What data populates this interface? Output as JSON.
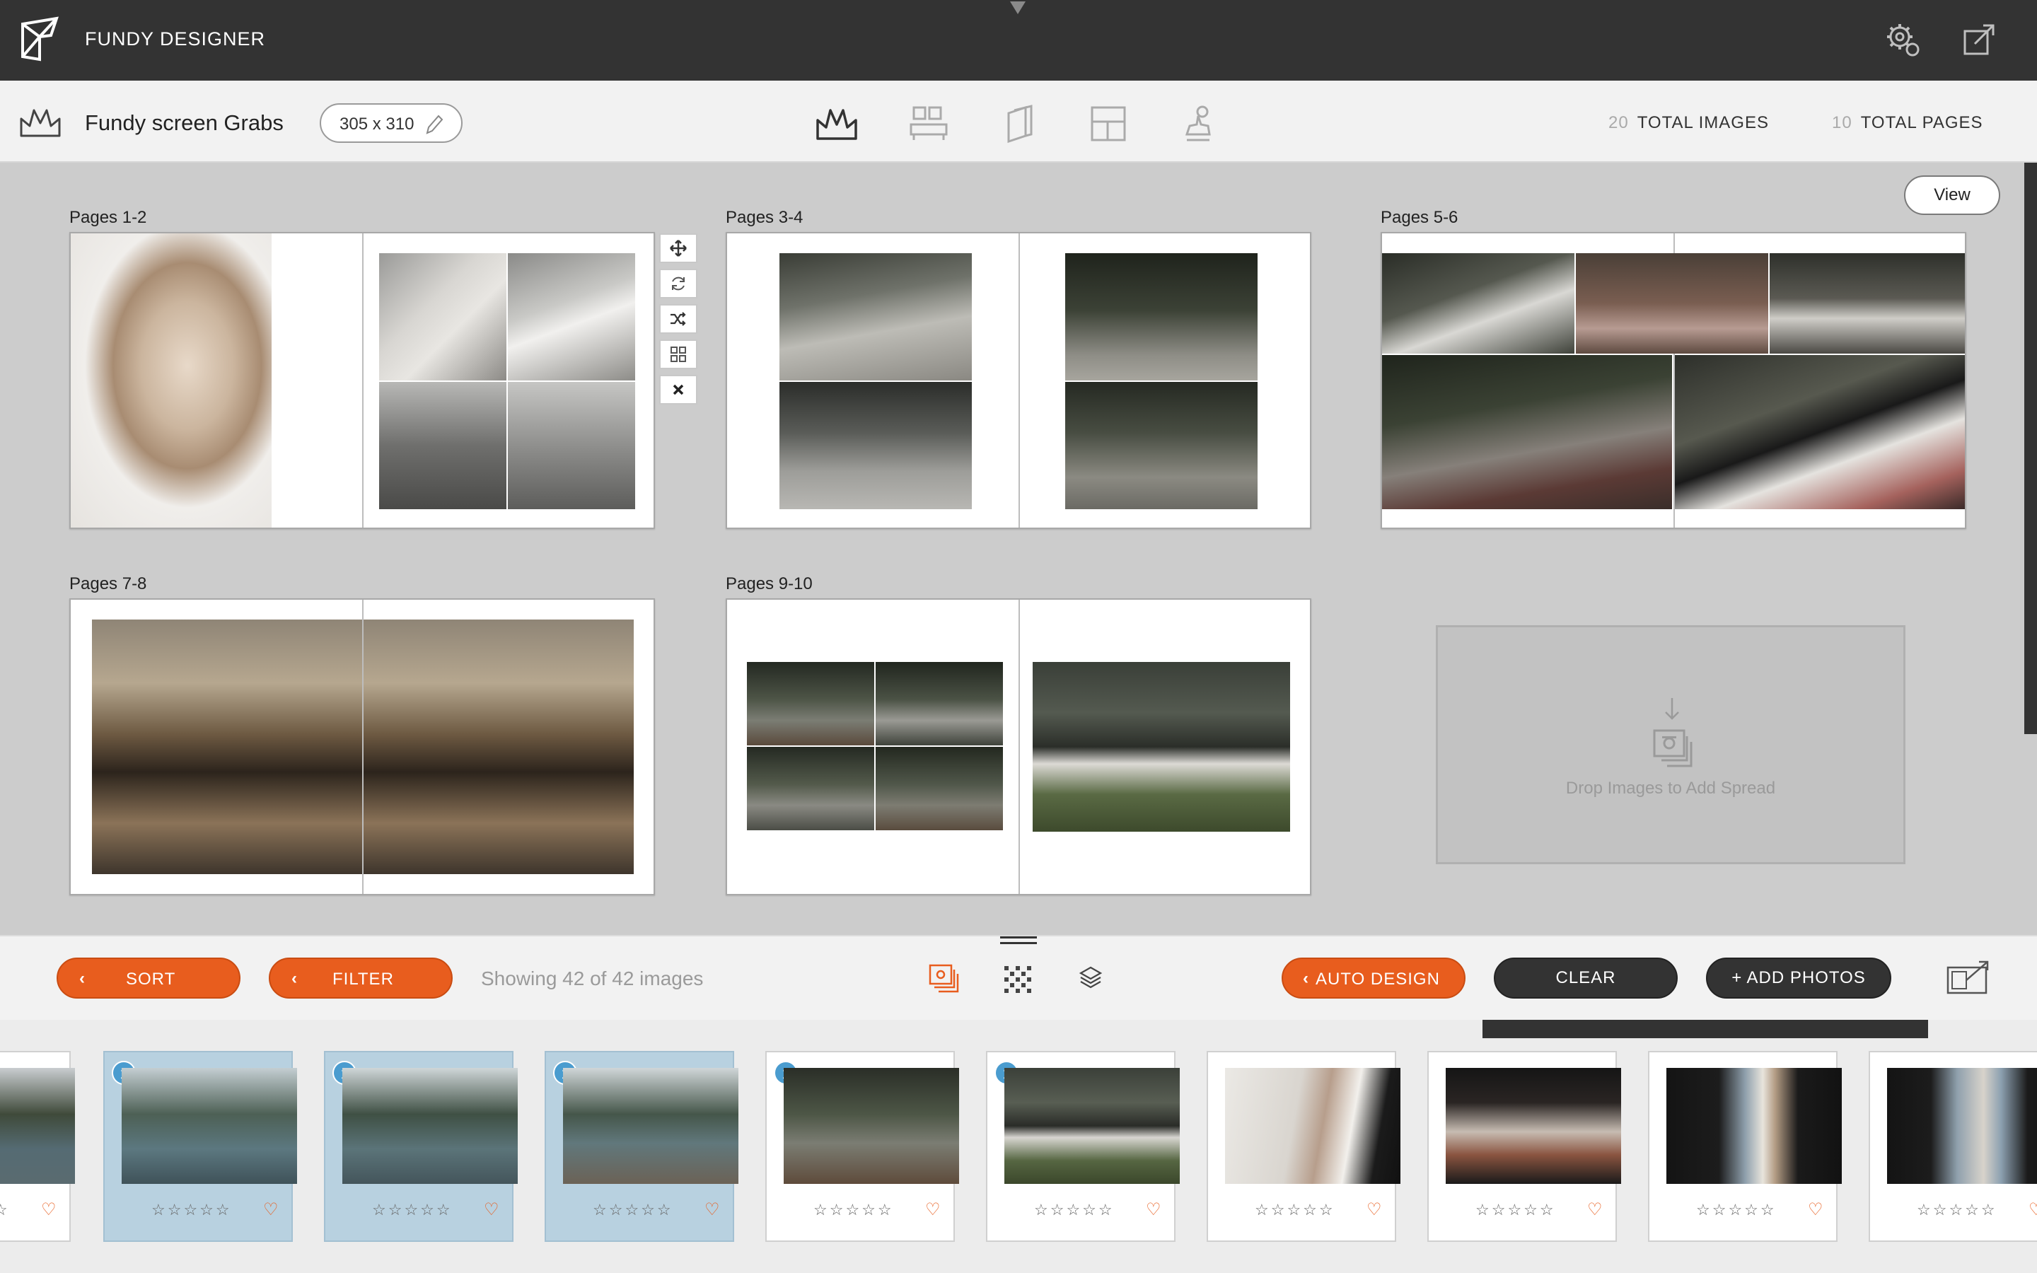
{
  "app": {
    "title": "FUNDY DESIGNER"
  },
  "project": {
    "name": "Fundy screen Grabs",
    "size": "305 x 310",
    "total_images_count": "20",
    "total_images_label": "TOTAL IMAGES",
    "total_pages_count": "10",
    "total_pages_label": "TOTAL PAGES"
  },
  "modes": [
    "album-mode-icon",
    "wall-display-icon",
    "cards-icon",
    "layout-grid-icon",
    "stamp-icon"
  ],
  "workspace": {
    "view_label": "View",
    "spreads": [
      {
        "label": "Pages 1-2"
      },
      {
        "label": "Pages 3-4"
      },
      {
        "label": "Pages 5-6"
      },
      {
        "label": "Pages 7-8"
      },
      {
        "label": "Pages 9-10"
      }
    ],
    "dropzone_text": "Drop Images to Add Spread"
  },
  "toolbar": {
    "sort_label": "SORT",
    "filter_label": "FILTER",
    "showing_text": "Showing 42 of 42 images",
    "auto_design_label": "AUTO DESIGN",
    "clear_label": "CLEAR",
    "add_photos_label": "+ ADD PHOTOS"
  },
  "filmstrip": {
    "thumbs": [
      {
        "badge": "",
        "stars": "☆☆☆☆☆",
        "heart": "♡",
        "selected": false
      },
      {
        "badge": "1",
        "stars": "☆☆☆☆☆",
        "heart": "♡",
        "selected": true
      },
      {
        "badge": "1",
        "stars": "☆☆☆☆☆",
        "heart": "♡",
        "selected": true
      },
      {
        "badge": "1",
        "stars": "☆☆☆☆☆",
        "heart": "♡",
        "selected": true
      },
      {
        "badge": "1",
        "stars": "☆☆☆☆☆",
        "heart": "♡",
        "selected": false
      },
      {
        "badge": "1",
        "stars": "☆☆☆☆☆",
        "heart": "♡",
        "selected": false
      },
      {
        "badge": "",
        "stars": "☆☆☆☆☆",
        "heart": "♡",
        "selected": false
      },
      {
        "badge": "",
        "stars": "☆☆☆☆☆",
        "heart": "♡",
        "selected": false
      },
      {
        "badge": "",
        "stars": "☆☆☆☆☆",
        "heart": "♡",
        "selected": false
      },
      {
        "badge": "",
        "stars": "☆☆☆☆☆",
        "heart": "♡",
        "selected": false
      }
    ]
  },
  "colors": {
    "accent": "#e85d1e",
    "dark": "#333333",
    "selected_thumb": "#b8d1e0",
    "badge": "#4a9ccf"
  }
}
